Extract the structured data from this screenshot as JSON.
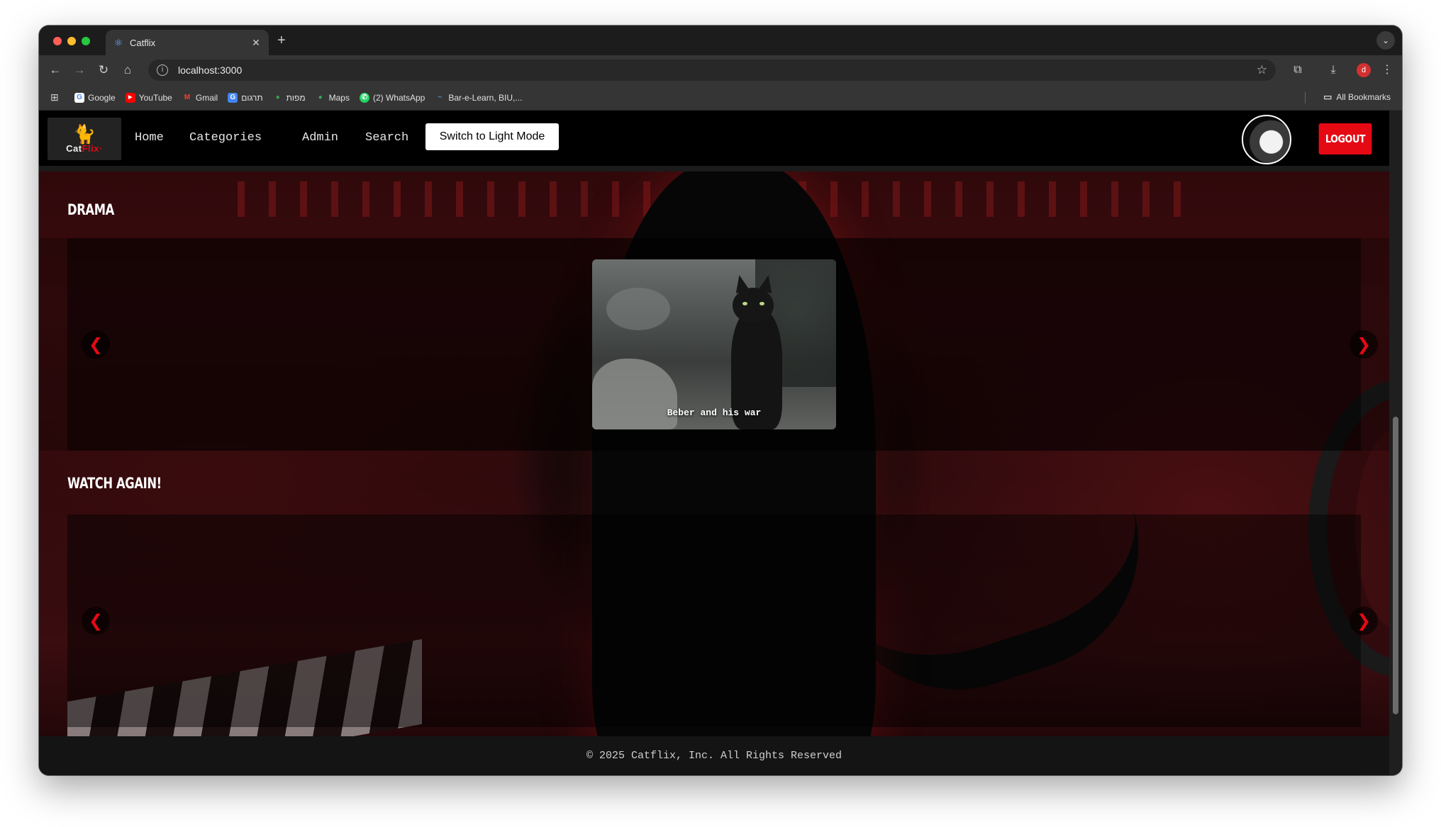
{
  "browser": {
    "tab_title": "Catflix",
    "tab_icon": "react-icon",
    "new_tab_symbol": "+",
    "address": "localhost:3000",
    "profile_initial": "d",
    "bookmarks": [
      {
        "label": "Google",
        "icon": "google-icon",
        "color": "#ffffff",
        "glyph": "G"
      },
      {
        "label": "YouTube",
        "icon": "youtube-icon",
        "color": "#ff0000",
        "glyph": "▶"
      },
      {
        "label": "Gmail",
        "icon": "gmail-icon",
        "color": "#ea4335",
        "glyph": "M"
      },
      {
        "label": "תרגום",
        "icon": "translate-icon",
        "color": "#4285f4",
        "glyph": "G"
      },
      {
        "label": "מפות",
        "icon": "maps-pin-icon",
        "color": "#34a853",
        "glyph": "●"
      },
      {
        "label": "Maps",
        "icon": "maps-pin-icon",
        "color": "#34a853",
        "glyph": "●"
      },
      {
        "label": "(2) WhatsApp",
        "icon": "whatsapp-icon",
        "color": "#25d366",
        "glyph": "✆"
      },
      {
        "label": "Bar-e-Learn, BIU,...",
        "icon": "elearn-icon",
        "color": "#4a8fdc",
        "glyph": "~"
      }
    ],
    "all_bookmarks_label": "All Bookmarks"
  },
  "site": {
    "logo": {
      "prefix": "Cat",
      "accent": "Flix",
      "suffix": "·"
    },
    "nav": {
      "home": "Home",
      "categories": "Categories",
      "admin": "Admin",
      "search": "Search"
    },
    "mode_toggle_label": "Switch to Light Mode",
    "logout_label": "LOGOUT",
    "accent_color": "#e50914"
  },
  "rows": [
    {
      "title": "DRAMA",
      "prev_arrow": "❮",
      "next_arrow": "❯",
      "items": [
        {
          "caption": "Beber and his war"
        }
      ]
    },
    {
      "title": "WATCH AGAIN!",
      "prev_arrow": "❮",
      "next_arrow": "❯",
      "items": []
    }
  ],
  "footer": {
    "text": "© 2025 Catflix, Inc. All Rights Reserved"
  }
}
